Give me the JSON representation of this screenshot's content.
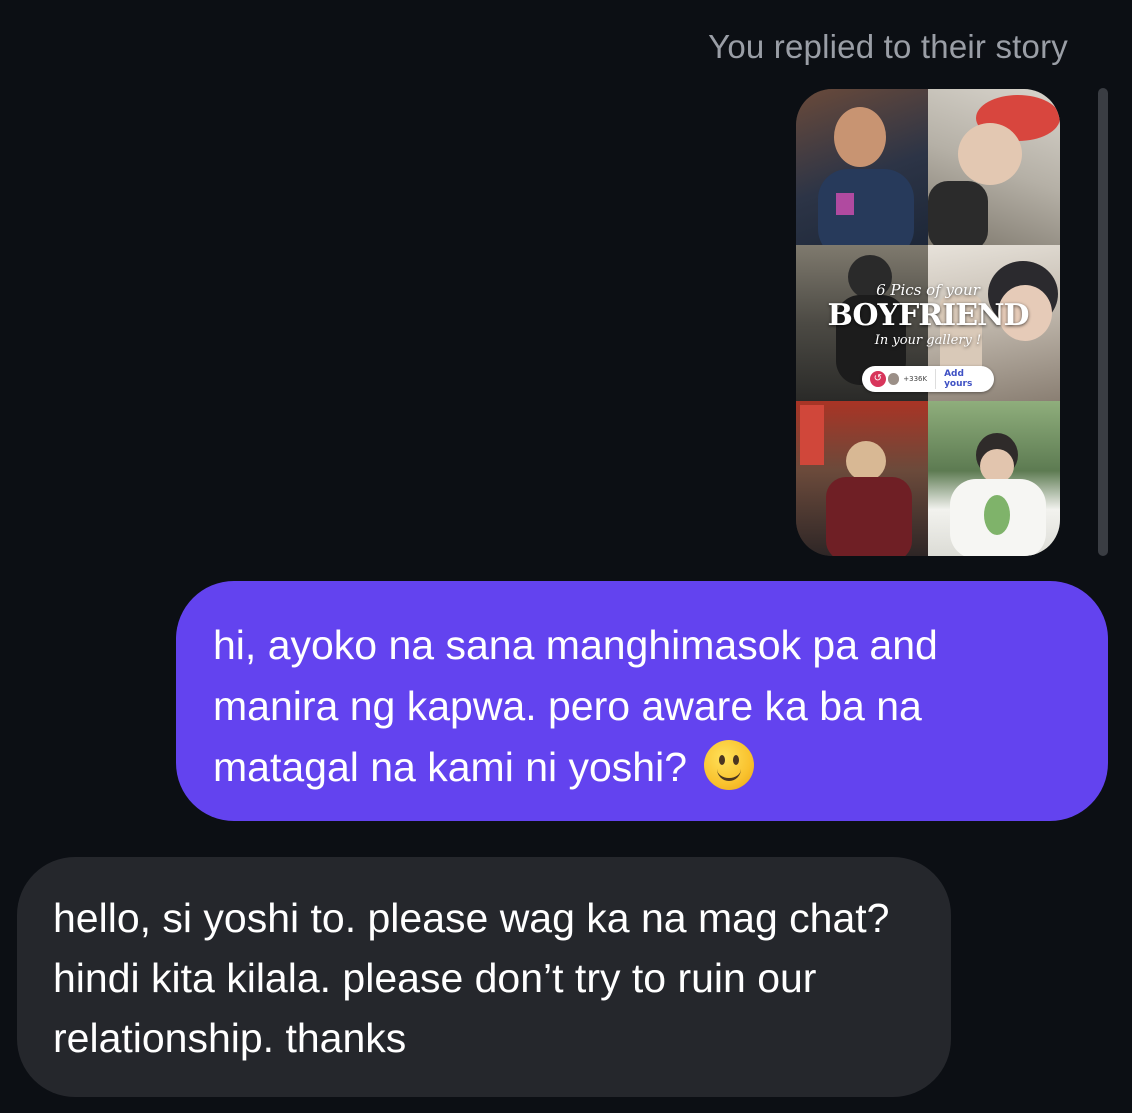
{
  "thread": {
    "story_reply_caption": "You replied to their story",
    "story": {
      "overlay_line1": "6 Pics of your",
      "overlay_line2": "BOYFRIEND",
      "overlay_line3": "In your gallery !",
      "add_yours_count": "+336K",
      "add_yours_label": "Add yours"
    },
    "messages": [
      {
        "sender": "me",
        "text": "hi, ayoko na sana manghimasok pa and manira ng kapwa. pero aware ka ba na matagal na kami ni yoshi?",
        "emoji": "slightly-smiling-face-icon"
      },
      {
        "sender": "them",
        "text": "hello, si yoshi to. please wag ka na mag chat? hindi kita kilala. please don’t try to ruin our relationship. thanks"
      }
    ]
  },
  "colors": {
    "background": "#0c0f14",
    "sent_bubble": "#6343ef",
    "received_bubble": "#25272c",
    "caption_text": "#9a9ea6",
    "message_text": "#ffffff"
  }
}
